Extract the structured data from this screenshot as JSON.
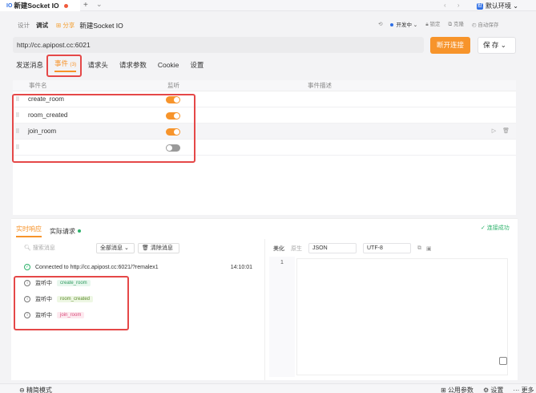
{
  "tabbar": {
    "io_badge": "IO",
    "active_tab": "新建Socket IO",
    "plus": "+",
    "more": "⌄",
    "nav": "‹ ›",
    "env_icon": "默",
    "env_label": "默认环境 ⌄"
  },
  "mode": {
    "design": "设计",
    "debug": "调试",
    "share": "⊞ 分享",
    "title": "新建Socket IO",
    "status": "开发中 ⌄",
    "lock": "锁定",
    "clone": "克隆",
    "autosave": "自动保存"
  },
  "url": {
    "value": "http://cc.apipost.cc:6021",
    "connect": "断开连接",
    "save": "保 存  ⌄"
  },
  "sectabs": {
    "send": "发送消息",
    "events": "事件",
    "events_count": "(3)",
    "headers": "请求头",
    "params": "请求参数",
    "cookie": "Cookie",
    "settings": "设置"
  },
  "events_table": {
    "headers": [
      "事件名",
      "监听",
      "事件描述"
    ],
    "rows": [
      {
        "name": "create_room",
        "on": true
      },
      {
        "name": "room_created",
        "on": true
      },
      {
        "name": "join_room",
        "on": true
      },
      {
        "name": "",
        "on": false
      }
    ]
  },
  "bottom": {
    "tab_realtime": "实时响应",
    "tab_actual": "实际请求",
    "conn_ok": "✓ 连接成功",
    "search_placeholder": "搜索消息",
    "filter": "全部消息 ⌄",
    "clear": "清除消息",
    "messages": [
      {
        "text": "Connected to http://cc.apipost.cc:6021/?remalex1",
        "time": "14:10:01"
      },
      {
        "text": "监听中",
        "tag": "create_room"
      },
      {
        "text": "监听中",
        "tag": "room_created"
      },
      {
        "text": "监听中",
        "tag": "join_room"
      }
    ],
    "beautify": "美化",
    "raw": "原生",
    "format": "JSON",
    "encoding": "UTF-8",
    "line1": "1"
  },
  "statusbar": {
    "left": "精简模式",
    "params": "公用参数",
    "settings": "设置",
    "more": "更多"
  },
  "colors": {
    "accent": "#f7942b",
    "highlight": "#e54848",
    "success": "#2db26b"
  }
}
